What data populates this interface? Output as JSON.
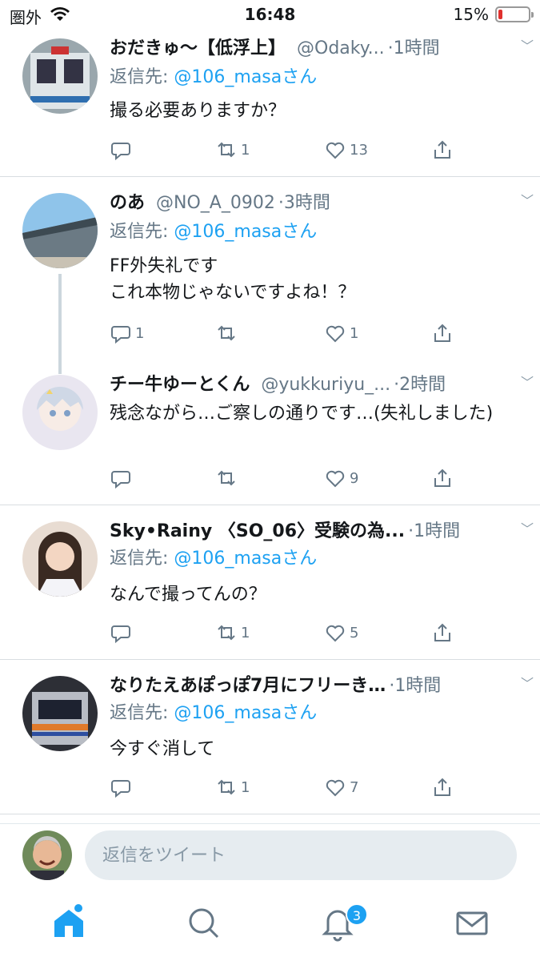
{
  "status_bar": {
    "carrier": "圏外",
    "time": "16:48",
    "battery_percent": "15%",
    "battery_level": 0.15
  },
  "tweets": [
    {
      "name": "おだきゅ〜【低浮上】",
      "handle": "@Odaky...",
      "time": "1時間",
      "reply_prefix": "返信先: ",
      "reply_to": "@106_masaさん",
      "text": "撮る必要ありますか？",
      "replies": "",
      "retweets": "1",
      "likes": "13"
    },
    {
      "name": "のあ",
      "handle": "@NO_A_0902",
      "time": "3時間",
      "reply_prefix": "返信先: ",
      "reply_to": "@106_masaさん",
      "text": "FF外失礼です\nこれ本物じゃないですよね！？",
      "replies": "1",
      "retweets": "",
      "likes": "1"
    },
    {
      "name": "チー牛ゆーとくん",
      "handle": "@yukkuriyu_...",
      "time": "2時間",
      "text": "残念ながら…ご察しの通りです…(失礼しました)",
      "replies": "",
      "retweets": "",
      "likes": "9"
    },
    {
      "name": "Sky•Rainy 〈SO_06〉受験の為...",
      "handle": "",
      "time": "1時間",
      "reply_prefix": "返信先: ",
      "reply_to": "@106_masaさん",
      "text": "なんで撮ってんの？",
      "replies": "",
      "retweets": "1",
      "likes": "5"
    },
    {
      "name": "なりたえあぽっぽ7月にフリーき…",
      "handle": "",
      "time": "1時間",
      "reply_prefix": "返信先: ",
      "reply_to": "@106_masaさん",
      "text": "今すぐ消して",
      "replies": "",
      "retweets": "1",
      "likes": "7"
    }
  ],
  "compose": {
    "placeholder": "返信をツイート"
  },
  "tabbar": {
    "notifications_badge": "3"
  },
  "colors": {
    "accent": "#1da1f2",
    "secondary_text": "#657786",
    "divider": "#d8dde1"
  }
}
